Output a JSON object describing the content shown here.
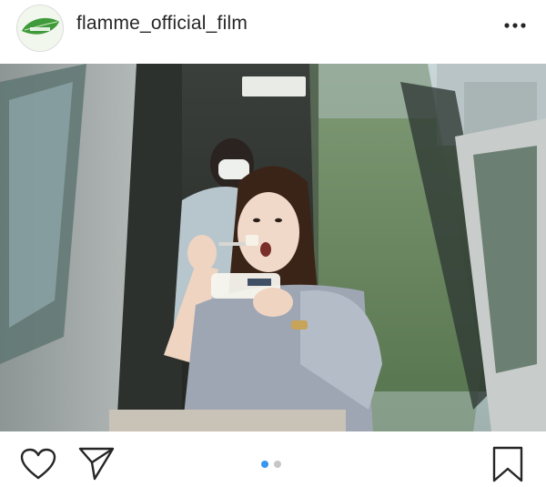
{
  "post": {
    "username": "flamme_official_film",
    "avatar_icon": "leaf-avatar-icon",
    "more_icon": "more-options-icon",
    "photo_description": "woman eating dessert on a bus",
    "carousel": {
      "total": 2,
      "active": 1
    }
  },
  "actions": {
    "like_icon": "heart-icon",
    "share_icon": "send-icon",
    "save_icon": "bookmark-icon"
  },
  "colors": {
    "text": "#262626",
    "dot_active": "#3897f0",
    "dot_inactive": "#c7c7c7",
    "divider": "#efefef"
  }
}
